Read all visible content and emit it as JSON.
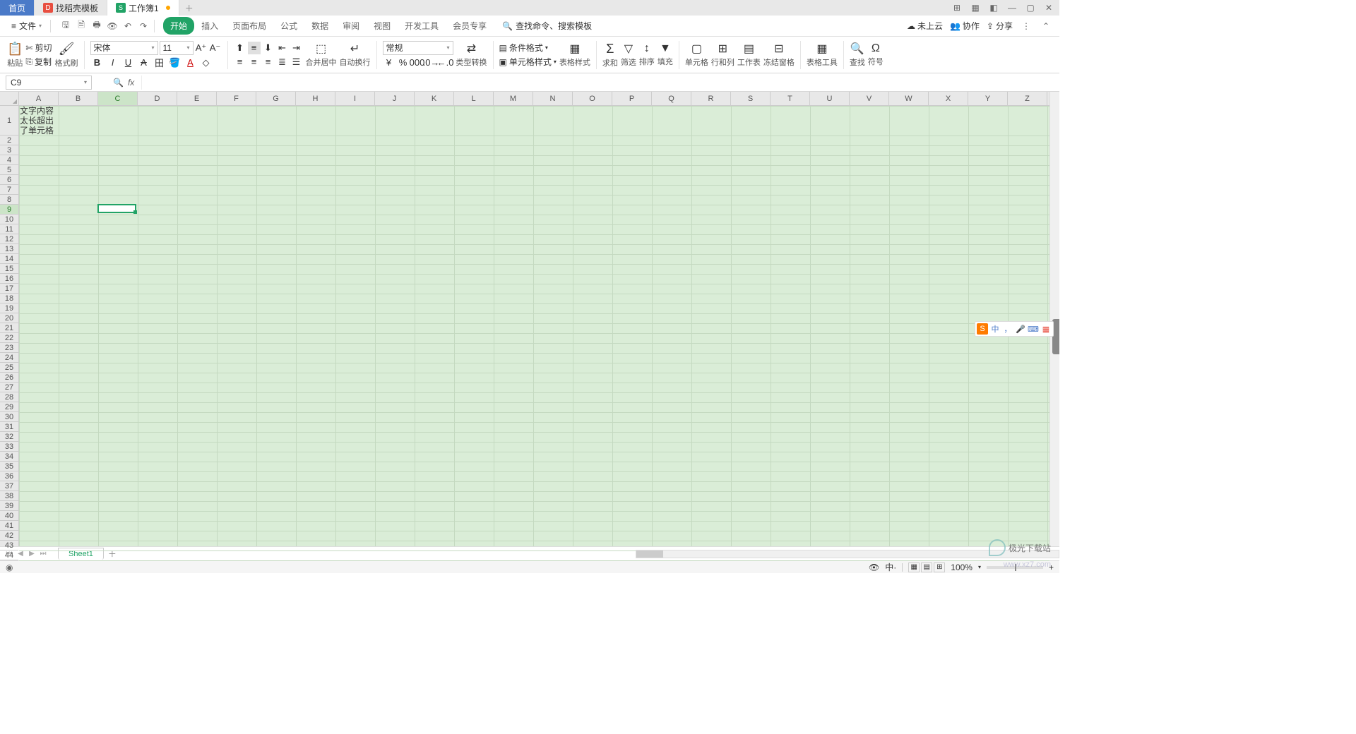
{
  "titlebar": {
    "tabs": [
      {
        "label": "首页",
        "type": "home"
      },
      {
        "label": "找稻壳模板",
        "type": "template"
      },
      {
        "label": "工作簿1",
        "type": "active",
        "modified": true
      }
    ]
  },
  "menubar": {
    "file_label": "文件",
    "tabs": [
      "开始",
      "插入",
      "页面布局",
      "公式",
      "数据",
      "审阅",
      "视图",
      "开发工具",
      "会员专享"
    ],
    "active_tab": "开始",
    "search_placeholder": "查找命令、搜索模板",
    "right": {
      "cloud": "未上云",
      "collab": "协作",
      "share": "分享"
    }
  },
  "ribbon": {
    "paste": "粘贴",
    "cut": "剪切",
    "copy": "复制",
    "format_painter": "格式刷",
    "font_name": "宋体",
    "font_size": "11",
    "merge": "合并居中",
    "wrap": "自动换行",
    "number_format": "常规",
    "type_convert": "类型转换",
    "cond_fmt": "条件格式",
    "table_style": "表格样式",
    "cell_style": "单元格样式",
    "sum": "求和",
    "filter": "筛选",
    "sort": "排序",
    "fill": "填充",
    "cell": "单元格",
    "rowcol": "行和列",
    "sheet": "工作表",
    "freeze": "冻结窗格",
    "table_tool": "表格工具",
    "find": "查找",
    "symbol": "符号"
  },
  "formula_bar": {
    "name_box": "C9",
    "fx": "fx"
  },
  "grid": {
    "columns": [
      "A",
      "B",
      "C",
      "D",
      "E",
      "F",
      "G",
      "H",
      "I",
      "J",
      "K",
      "L",
      "M",
      "N",
      "O",
      "P",
      "Q",
      "R",
      "S",
      "T",
      "U",
      "V",
      "W",
      "X",
      "Y",
      "Z"
    ],
    "row_count": 44,
    "selected_col": "C",
    "selected_row": 9,
    "a1_text": "文字内容太长超出了单元格"
  },
  "sheets": {
    "active": "Sheet1"
  },
  "statusbar": {
    "zoom": "100%"
  },
  "watermark": {
    "brand": "极光下载站",
    "url": "www.xz7.com"
  },
  "ime": {
    "lang": "中",
    "punct": "，",
    "mic": "🎤",
    "kb": "⌨",
    "grid": "▦"
  }
}
